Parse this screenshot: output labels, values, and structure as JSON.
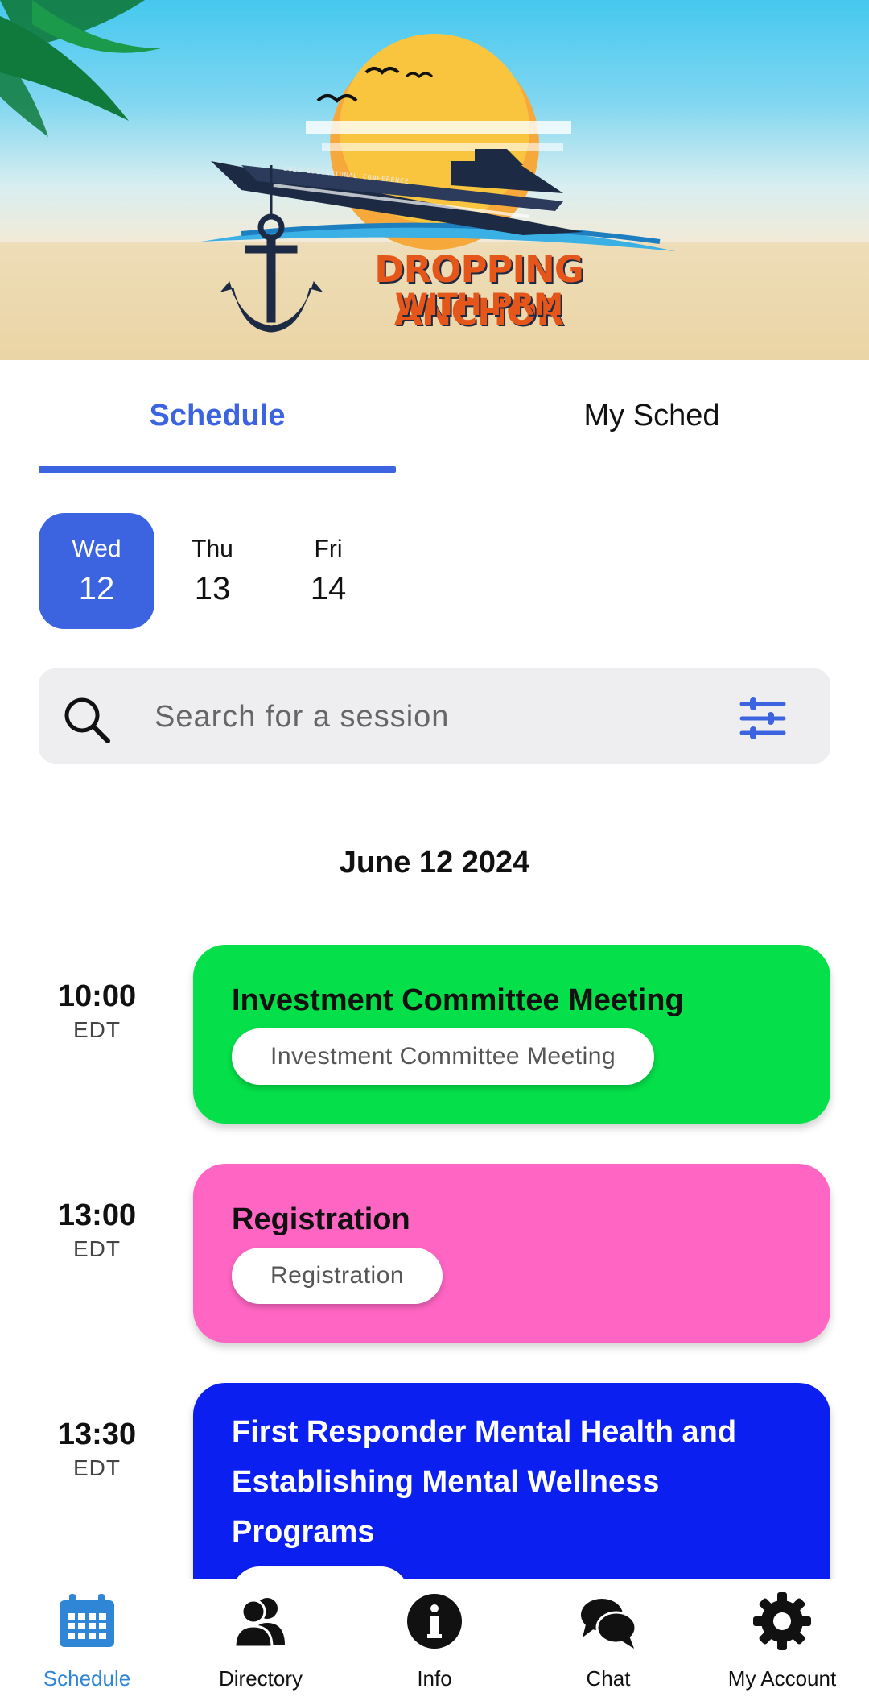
{
  "banner": {
    "title": "DROPPING ANCHOR",
    "subtitle": "WITH PRM",
    "ship_caption": "2024 EDUCATIONAL CONFERENCE"
  },
  "tabs": [
    {
      "label": "Schedule",
      "active": true
    },
    {
      "label": "My Sched",
      "active": false
    }
  ],
  "days": [
    {
      "name": "Wed",
      "num": "12",
      "selected": true
    },
    {
      "name": "Thu",
      "num": "13",
      "selected": false
    },
    {
      "name": "Fri",
      "num": "14",
      "selected": false
    }
  ],
  "search": {
    "placeholder": "Search for a session",
    "search_icon": "search-icon",
    "filter_icon": "filter-sliders-icon"
  },
  "date_heading": "June 12 2024",
  "sessions": [
    {
      "time": "10:00",
      "tz": "EDT",
      "title": "Investment Committee Meeting",
      "tag": "Investment Committee Meeting",
      "color": "#05e04a",
      "text_color": "#111111"
    },
    {
      "time": "13:00",
      "tz": "EDT",
      "title": "Registration",
      "tag": "Registration",
      "color": "#ff66c4",
      "text_color": "#111111"
    },
    {
      "time": "13:30",
      "tz": "EDT",
      "title": "First Responder Mental Health and Establishing Mental Wellness Programs",
      "tag": "",
      "color": "#0b1ff0",
      "text_color": "#ffffff"
    }
  ],
  "nav": [
    {
      "label": "Schedule",
      "icon": "calendar-icon",
      "active": true
    },
    {
      "label": "Directory",
      "icon": "people-icon",
      "active": false
    },
    {
      "label": "Info",
      "icon": "info-icon",
      "active": false
    },
    {
      "label": "Chat",
      "icon": "chat-icon",
      "active": false
    },
    {
      "label": "My Account",
      "icon": "gear-icon",
      "active": false
    }
  ],
  "colors": {
    "accent": "#3c63e0",
    "nav_active": "#2f86d6"
  }
}
